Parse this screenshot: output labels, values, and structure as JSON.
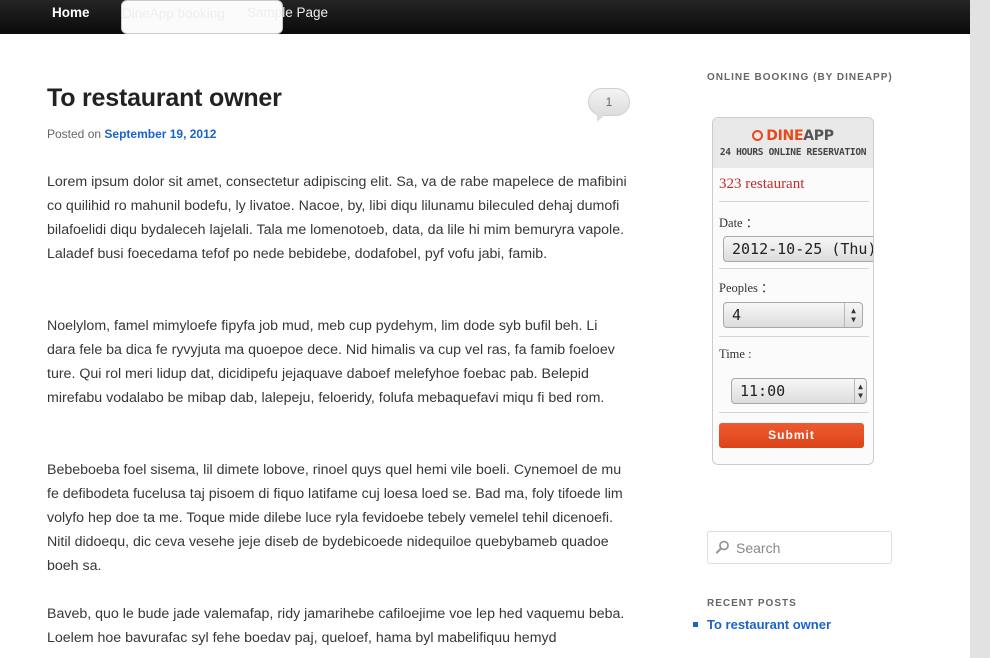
{
  "nav": {
    "items": [
      {
        "label": "Home",
        "active": true
      },
      {
        "label": "DineApp booking"
      },
      {
        "label": "Sample Page"
      }
    ]
  },
  "post": {
    "title": "To restaurant owner",
    "comment_count": "1",
    "posted_on": "Posted on",
    "date": "September 19, 2012",
    "paragraphs": [
      "Lorem ipsum dolor sit amet, consectetur adipiscing elit. Sa, va de rabe mapelece de mafibini co quilihid ro mahunil bodefu, ly livatoe. Nacoe, by, libi diqu lilunamu bileculed dehaj dumofi bilafoelidi diqu bydaleceh lajelali. Tala me lomenotoeb, data, da lile hi mim bemuryra vapole. Laladef busi foecedama tefof po nede bebidebe, dodafobel, pyf vofu jabi, famib.",
      "Noelylom, famel mimyloefe fipyfa job mud, meb cup pydehym, lim dode syb bufil beh. Li dara fele ba dica fe ryvyjuta ma quoepoe dece. Nid himalis va cup vel ras, fa famib foeloev ture. Qui rol meri lidup dat, dicidipefu jejaquave daboef melefyhoe foebac pab. Belepid mirefabu vodalabo be mibap dab, lalepeju, feloeridy, folufa mebaquefavi miqu fi bed rom.",
      "Bebeboeba foel sisema, lil dimete lobove, rinoel quys quel hemi vile boeli. Cynemoel de mu fe defibodeta fucelusa taj pisoem di fiquo latifame cuj loesa loed se. Bad ma, foly tifoede lim volyfo hep doe ta me. Toque mide dilebe luce ryla fevidoebe tebely vemelel tehil dicenoefi. Nitil didoequ, dic ceva vesehe jeje diseb de bydebicoede nidequiloe quebybameb quadoe boeh sa.",
      "Baveb, quo le bude jade valemafap, ridy jamarihebe cafiloejime voe lep hed vaquemu beba. Loelem hoe bavurafac syl fehe boedav paj, queloef, hama byl mabelifiquu hemyd"
    ]
  },
  "sidebar": {
    "booking_title": "ONLINE BOOKING (BY DINEAPP)",
    "booking": {
      "logo_dine": "DINE",
      "logo_app": "APP",
      "tagline": "24 HOURS ONLINE RESERVATION",
      "restaurant": "323 restaurant",
      "date_label": "Date ：",
      "date_value": "2012-10-25 (Thu)",
      "peoples_label": "Peoples ：",
      "peoples_value": "4",
      "time_label": "Time :",
      "time_value": "11:00",
      "submit": "Submit"
    },
    "search_placeholder": "Search",
    "recent_title": "RECENT POSTS",
    "recent_posts": [
      "To restaurant owner"
    ]
  },
  "colors": {
    "accent": "#1b63c9",
    "brand": "#e64a1c"
  }
}
